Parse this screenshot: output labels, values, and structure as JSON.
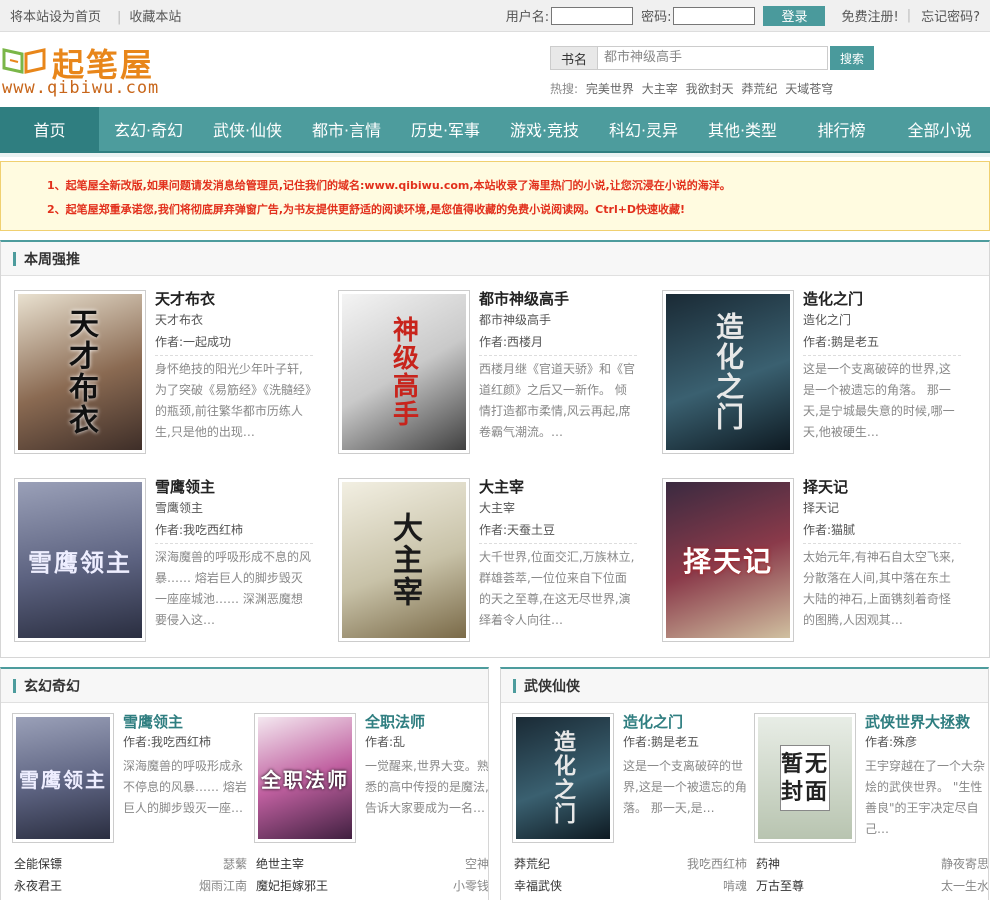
{
  "topbar": {
    "set_home": "将本站设为首页",
    "favorite": "收藏本站",
    "username_label": "用户名:",
    "password_label": "密码:",
    "login": "登录",
    "register": "免费注册!",
    "forgot": "忘记密码?"
  },
  "header": {
    "logo_text": "起笔屋",
    "logo_url": "www.qibiwu.com",
    "search_label": "书名",
    "search_value": "都市神级高手",
    "search_button": "搜索",
    "hot_label": "热搜:",
    "hot_items": [
      "完美世界",
      "大主宰",
      "我欲封天",
      "莽荒纪",
      "天域苍穹"
    ]
  },
  "nav": [
    "首页",
    "玄幻·奇幻",
    "武侠·仙侠",
    "都市·言情",
    "历史·军事",
    "游戏·竞技",
    "科幻·灵异",
    "其他·类型",
    "排行榜",
    "全部小说"
  ],
  "notice": [
    "1、起笔屋全新改版,如果问题请发消息给管理员,记住我们的域名:www.qibiwu.com,本站收录了海里热门的小说,让您沉浸在小说的海洋。",
    "2、起笔屋郑重承诺您,我们将彻底屏弃弹窗广告,为书友提供更舒适的阅读环境,是您值得收藏的免费小说阅读网。Ctrl+D快速收藏!"
  ],
  "recommend": {
    "title": "本周强推",
    "books": [
      {
        "title": "天才布衣",
        "sub": "天才布衣",
        "author": "作者:一起成功",
        "desc": "身怀绝技的阳光少年叶子轩,为了突破《易筋经》《洗髓经》的瓶颈,前往繁华都市历练人生,只是他的出现…",
        "cover": "天才布衣"
      },
      {
        "title": "都市神级高手",
        "sub": "都市神级高手",
        "author": "作者:西楼月",
        "desc": "西楼月继《官道天骄》和《官道红颜》之后又一新作。 倾情打造都市柔情,风云再起,席卷霸气潮流。…",
        "cover": "神级高手"
      },
      {
        "title": "造化之门",
        "sub": "造化之门",
        "author": "作者:鹅是老五",
        "desc": "这是一个支离破碎的世界,这是一个被遗忘的角落。 那一天,是宁城最失意的时候,哪一天,他被硬生…",
        "cover": "造化之门"
      },
      {
        "title": "雪鹰领主",
        "sub": "雪鹰领主",
        "author": "作者:我吃西红柿",
        "desc": "深海魔兽的呼吸形成不息的风暴…… 熔岩巨人的脚步毁灭一座座城池…… 深渊恶魔想要侵入这…",
        "cover": "雪鹰领主"
      },
      {
        "title": "大主宰",
        "sub": "大主宰",
        "author": "作者:天蚕土豆",
        "desc": "大千世界,位面交汇,万族林立,群雄荟萃,一位位来自下位面的天之至尊,在这无尽世界,演绎着令人向往…",
        "cover": "大主宰"
      },
      {
        "title": "择天记",
        "sub": "择天记",
        "author": "作者:猫腻",
        "desc": "太始元年,有神石自太空飞来,分散落在人间,其中落在东土大陆的神石,上面镌刻着奇怪的图腾,人因观其…",
        "cover": "择天记"
      }
    ]
  },
  "xuanhuan": {
    "title": "玄幻奇幻",
    "books": [
      {
        "title": "雪鹰领主",
        "author": "作者:我吃西红柿",
        "desc": "深海魔兽的呼吸形成永不停息的风暴…… 熔岩巨人的脚步毁灭一座…",
        "cover": "雪鹰领主"
      },
      {
        "title": "全职法师",
        "author": "作者:乱",
        "desc": "一觉醒来,世界大变。熟悉的高中传授的是魔法,告诉大家要成为一名…",
        "cover": "全职法师"
      }
    ],
    "links": [
      {
        "name": "全能保镖",
        "author": "瑟蘩"
      },
      {
        "name": "绝世主宰",
        "author": "空神"
      },
      {
        "name": "永夜君王",
        "author": "烟雨江南"
      },
      {
        "name": "魔妃拒嫁邪王",
        "author": "小零钱"
      }
    ]
  },
  "wuxia": {
    "title": "武侠仙侠",
    "books": [
      {
        "title": "造化之门",
        "author": "作者:鹅是老五",
        "desc": "这是一个支离破碎的世界,这是一个被遗忘的角落。 那一天,是…",
        "cover": "造化之门"
      },
      {
        "title": "武侠世界大拯救",
        "author": "作者:殊彦",
        "desc": "王宇穿越在了一个大杂烩的武侠世界。 \"生性善良\"的王宇决定尽自己…",
        "cover": "暂无封面"
      }
    ],
    "links": [
      {
        "name": "莽荒纪",
        "author": "我吃西红柿"
      },
      {
        "name": "药神",
        "author": "静夜寄思"
      },
      {
        "name": "幸福武侠",
        "author": "啃魂"
      },
      {
        "name": "万古至尊",
        "author": "太一生水"
      }
    ]
  },
  "colors": {
    "accent": "#4d9c9d",
    "accent_dark": "#2f7e80",
    "notice_red": "#e2301c",
    "logo_orange": "#e8861a"
  }
}
